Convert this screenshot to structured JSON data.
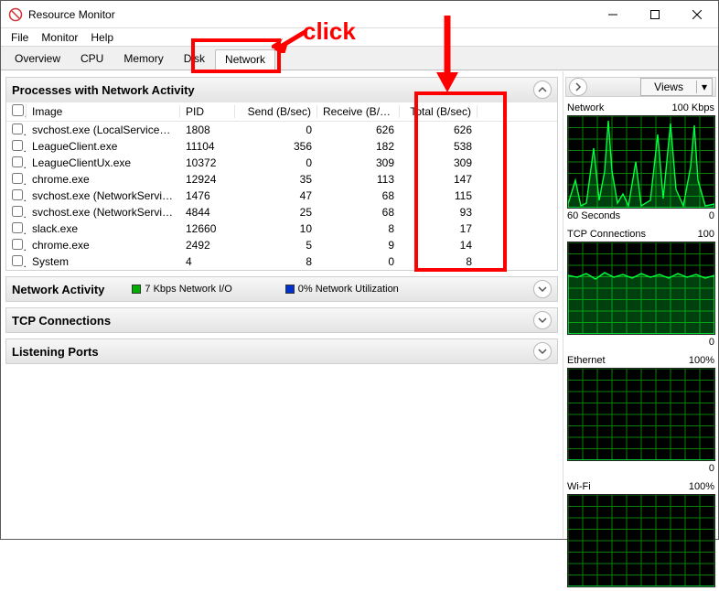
{
  "window": {
    "title": "Resource Monitor"
  },
  "menu": {
    "file": "File",
    "monitor": "Monitor",
    "help": "Help"
  },
  "tabs": {
    "overview": "Overview",
    "cpu": "CPU",
    "memory": "Memory",
    "disk": "Disk",
    "network": "Network"
  },
  "panels": {
    "processes": {
      "title": "Processes with Network Activity",
      "columns": {
        "image": "Image",
        "pid": "PID",
        "send": "Send (B/sec)",
        "recv": "Receive (B/sec)",
        "total": "Total (B/sec)"
      },
      "rows": [
        {
          "image": "svchost.exe (LocalServiceAn...",
          "pid": "1808",
          "send": "0",
          "recv": "626",
          "total": "626"
        },
        {
          "image": "LeagueClient.exe",
          "pid": "11104",
          "send": "356",
          "recv": "182",
          "total": "538"
        },
        {
          "image": "LeagueClientUx.exe",
          "pid": "10372",
          "send": "0",
          "recv": "309",
          "total": "309"
        },
        {
          "image": "chrome.exe",
          "pid": "12924",
          "send": "35",
          "recv": "113",
          "total": "147"
        },
        {
          "image": "svchost.exe (NetworkService...",
          "pid": "1476",
          "send": "47",
          "recv": "68",
          "total": "115"
        },
        {
          "image": "svchost.exe (NetworkService...",
          "pid": "4844",
          "send": "25",
          "recv": "68",
          "total": "93"
        },
        {
          "image": "slack.exe",
          "pid": "12660",
          "send": "10",
          "recv": "8",
          "total": "17"
        },
        {
          "image": "chrome.exe",
          "pid": "2492",
          "send": "5",
          "recv": "9",
          "total": "14"
        },
        {
          "image": "System",
          "pid": "4",
          "send": "8",
          "recv": "0",
          "total": "8"
        }
      ]
    },
    "netactivity": {
      "title": "Network Activity",
      "io_label": "7 Kbps Network I/O",
      "util_label": "0% Network Utilization"
    },
    "tcp": {
      "title": "TCP Connections"
    },
    "listening": {
      "title": "Listening Ports"
    }
  },
  "right": {
    "views": "Views",
    "graphs": [
      {
        "title": "Network",
        "right": "100 Kbps",
        "foot_left": "60 Seconds",
        "foot_right": "0"
      },
      {
        "title": "TCP Connections",
        "right": "100",
        "foot_left": "",
        "foot_right": "0"
      },
      {
        "title": "Ethernet",
        "right": "100%",
        "foot_left": "",
        "foot_right": "0"
      },
      {
        "title": "Wi-Fi",
        "right": "100%",
        "foot_left": "",
        "foot_right": ""
      }
    ]
  },
  "annotations": {
    "click": "click"
  }
}
